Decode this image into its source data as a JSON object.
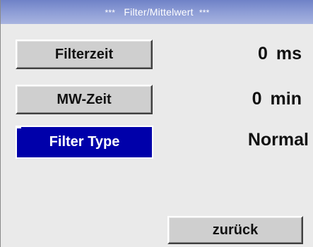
{
  "header": {
    "title_prefix": "***",
    "title": "Filter/Mittelwert",
    "title_suffix": "***"
  },
  "settings": {
    "filterzeit": {
      "label": "Filterzeit",
      "value": "0",
      "unit": "ms"
    },
    "mwzeit": {
      "label": "MW-Zeit",
      "value": "0",
      "unit": "min"
    },
    "filter_type": {
      "label": "Filter Type",
      "value": "Normal"
    }
  },
  "footer": {
    "back_label": "zurück"
  },
  "colors": {
    "title_bar": "#8a9ad4",
    "selected_button": "#0000aa",
    "button_face": "#cfcfcf",
    "background": "#eaeaea"
  }
}
